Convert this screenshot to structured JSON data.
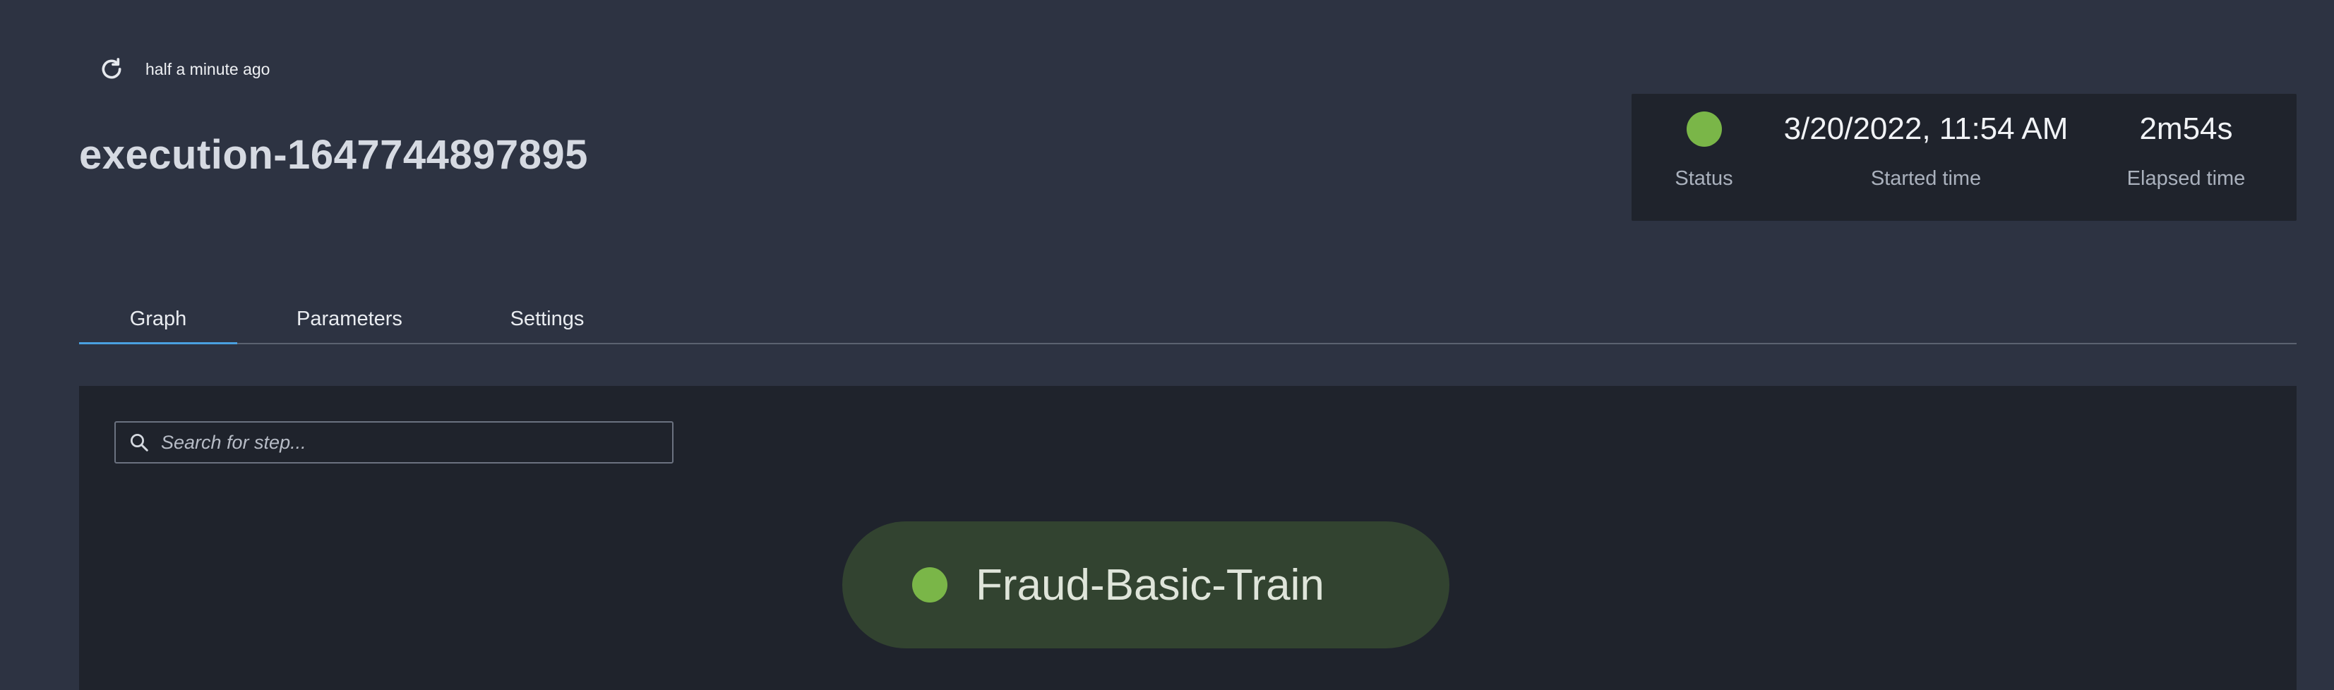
{
  "header": {
    "refresh_icon": "refresh-icon",
    "last_refreshed": "half a minute ago",
    "title": "execution-1647744897895"
  },
  "summary": {
    "status": {
      "label": "Status",
      "color": "#7ab648"
    },
    "started": {
      "value": "3/20/2022, 11:54 AM",
      "label": "Started time"
    },
    "elapsed": {
      "value": "2m54s",
      "label": "Elapsed time"
    }
  },
  "tabs": [
    {
      "label": "Graph",
      "active": true
    },
    {
      "label": "Parameters",
      "active": false
    },
    {
      "label": "Settings",
      "active": false
    }
  ],
  "graph": {
    "search": {
      "placeholder": "Search for step...",
      "value": "",
      "icon": "search-icon"
    },
    "steps": [
      {
        "name": "Fraud-Basic-Train",
        "status_color": "#7ab648"
      }
    ]
  },
  "colors": {
    "background": "#2d3342",
    "panel": "#1f232c",
    "accent": "#4aa0e0",
    "success": "#7ab648",
    "step_fill": "#324330"
  }
}
